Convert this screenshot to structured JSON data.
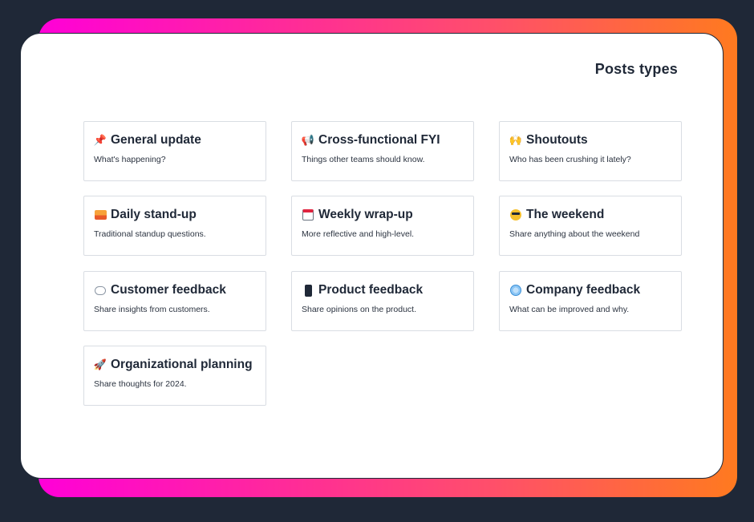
{
  "panel": {
    "title": "Posts types"
  },
  "cards": [
    {
      "icon": "pushpin-icon",
      "glyph": "📌",
      "title": "General update",
      "desc": "What's happening?"
    },
    {
      "icon": "megaphone-icon",
      "glyph": "📢",
      "title": "Cross-functional FYI",
      "desc": "Things other teams should know."
    },
    {
      "icon": "raised-hands-icon",
      "glyph": "🙌",
      "title": "Shoutouts",
      "desc": "Who has been crushing it lately?"
    },
    {
      "icon": "sunrise-icon",
      "glyph": "",
      "title": "Daily stand-up",
      "desc": "Traditional standup questions."
    },
    {
      "icon": "calendar-icon",
      "glyph": "",
      "title": "Weekly wrap-up",
      "desc": "More reflective and high-level."
    },
    {
      "icon": "sunglasses-face-icon",
      "glyph": "",
      "title": "The weekend",
      "desc": "Share anything about the weekend"
    },
    {
      "icon": "speech-bubble-icon",
      "glyph": "",
      "title": "Customer feedback",
      "desc": "Share insights from customers."
    },
    {
      "icon": "mobile-phone-icon",
      "glyph": "",
      "title": "Product feedback",
      "desc": "Share opinions on the product."
    },
    {
      "icon": "globe-icon",
      "glyph": "",
      "title": "Company feedback",
      "desc": "What can be improved and why."
    },
    {
      "icon": "rocket-icon",
      "glyph": "🚀",
      "title": "Organizational planning",
      "desc": "Share thoughts for 2024."
    }
  ]
}
